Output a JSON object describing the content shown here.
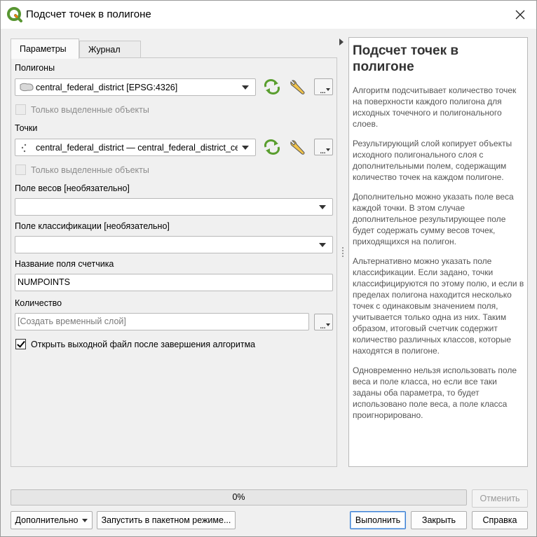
{
  "window": {
    "title": "Подсчет точек в полигоне"
  },
  "tabs": [
    {
      "label": "Параметры"
    },
    {
      "label": "Журнал"
    }
  ],
  "params": {
    "polygons": {
      "label": "Полигоны",
      "value": "central_federal_district [EPSG:4326]",
      "selected_only": "Только выделенные объекты"
    },
    "points": {
      "label": "Точки",
      "value": "central_federal_district — central_federal_district_centroid",
      "selected_only": "Только выделенные объекты"
    },
    "weight_field": {
      "label": "Поле весов [необязательно]",
      "value": ""
    },
    "class_field": {
      "label": "Поле классификации [необязательно]",
      "value": ""
    },
    "count_field": {
      "label": "Название поля счетчика",
      "value": "NUMPOINTS"
    },
    "output": {
      "label": "Количество",
      "placeholder": "[Создать временный слой]"
    },
    "open_after": {
      "label": "Открыть выходной файл после завершения алгоритма",
      "checked": true
    },
    "browse_label": "..."
  },
  "help": {
    "title": "Подсчет точек в полигоне",
    "paragraphs": [
      "Алгоритм подсчитывает количество точек на поверхности каждого полигона для исходных точечного и полигонального слоев.",
      "Результирующий слой копирует объекты исходного полигонального слоя с дополнительными полем, содержащим количество точек на каждом полигоне.",
      "Дополнительно можно указать поле веса каждой точки. В этом случае дополнительное результирующее поле будет содержать сумму весов точек, приходящихся на полигон.",
      "Альтернативно можно указать поле классификации. Если задано, точки классифицируются по этому полю, и если в пределах полигона находится несколько точек с одинаковым значением поля, учитывается только одна из них. Таким образом, итоговый счетчик содержит количество различных классов, которые находятся в полигоне.",
      "Одновременно нельзя использовать поле веса и поле класса, но если все таки заданы оба параметра, то будет использовано поле веса, а поле класса проигнорировано."
    ]
  },
  "progress": {
    "value": 0,
    "label": "0%"
  },
  "buttons": {
    "cancel": "Отменить",
    "advanced": "Дополнительно",
    "batch": "Запустить в пакетном режиме...",
    "run": "Выполнить",
    "close": "Закрыть",
    "help": "Справка"
  },
  "colors": {
    "accent": "#3c7fd1",
    "qgis_green": "#589632",
    "qgis_yellow": "#ee7913"
  }
}
